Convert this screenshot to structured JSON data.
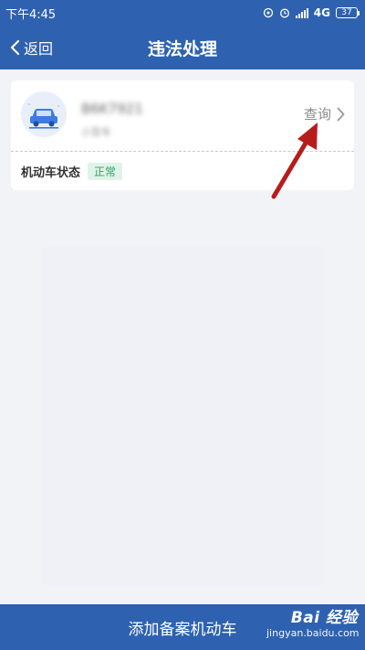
{
  "status_bar": {
    "time": "下午4:45",
    "network": "4G",
    "battery": "37"
  },
  "nav": {
    "back_label": "返回",
    "title": "违法处理"
  },
  "vehicle_card": {
    "plate_number": "B6K7921",
    "plate_sub": "小型车",
    "query_label": "查询",
    "status_label": "机动车状态",
    "status_value": "正常"
  },
  "bottom": {
    "add_vehicle_label": "添加备案机动车"
  },
  "watermark": {
    "brand": "Bai 经验",
    "url": "jingyan.baidu.com"
  },
  "colors": {
    "primary": "#2e62b0",
    "status_ok": "#2aa56a",
    "annotation": "#b71c1c"
  }
}
